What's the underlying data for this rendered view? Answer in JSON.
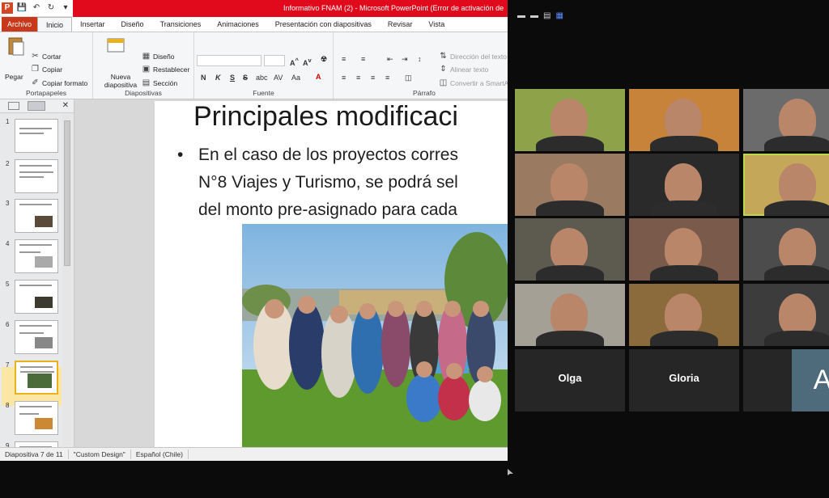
{
  "ppt": {
    "title": "Informativo FNAM (2) - Microsoft PowerPoint (Error de activación de",
    "qat_icon": "P",
    "tabs": [
      "Archivo",
      "Inicio",
      "Insertar",
      "Diseño",
      "Transiciones",
      "Animaciones",
      "Presentación con diapositivas",
      "Revisar",
      "Vista"
    ],
    "ribbon": {
      "portapapeles": {
        "label": "Portapapeles",
        "paste": "Pegar",
        "cut": "Cortar",
        "copy": "Copiar",
        "format": "Copiar formato"
      },
      "diapositivas": {
        "label": "Diapositivas",
        "new": "Nueva diapositiva",
        "layout": "Diseño",
        "reset": "Restablecer",
        "section": "Sección"
      },
      "fuente": {
        "label": "Fuente",
        "bold": "N",
        "italic": "K",
        "underline": "S",
        "strike": "S",
        "aa": "Aa",
        "a": "A"
      },
      "parrafo": {
        "label": "Párrafo",
        "dir": "Dirección del texto",
        "align": "Alinear texto",
        "smart": "Convertir a SmartArt"
      }
    },
    "thumbnails": [
      {
        "num": "1"
      },
      {
        "num": "2"
      },
      {
        "num": "3"
      },
      {
        "num": "4"
      },
      {
        "num": "5"
      },
      {
        "num": "6"
      },
      {
        "num": "7"
      },
      {
        "num": "8"
      },
      {
        "num": "9"
      }
    ],
    "slide": {
      "title": "Principales modificaci",
      "bullet_dot": "•",
      "line1": "En el caso de los proyectos corres",
      "line2": "N°8 Viajes y Turismo, se podrá sel",
      "line3": "del monto pre-asignado  para cada"
    },
    "status": {
      "slide_count": "Diapositiva 7 de 11",
      "theme": "\"Custom Design\"",
      "lang": "Español (Chile)"
    }
  },
  "zoom": {
    "participants": [
      {
        "name": "",
        "bg": "#8ea24a"
      },
      {
        "name": "",
        "bg": "#c8833a"
      },
      {
        "name": "",
        "bg": "#6b6b6b"
      },
      {
        "name": "",
        "bg": "#9b7a62"
      },
      {
        "name": "",
        "bg": "#2a2a2a"
      },
      {
        "name": "",
        "bg": "#c5a75a"
      },
      {
        "name": "",
        "bg": "#5d5a4f"
      },
      {
        "name": "",
        "bg": "#7a5a4a"
      },
      {
        "name": "",
        "bg": "#4c4c4c"
      },
      {
        "name": "",
        "bg": "#a5a096"
      },
      {
        "name": "",
        "bg": "#8b6a3c"
      },
      {
        "name": "",
        "bg": "#3c3c3c"
      },
      {
        "name": "Olga",
        "bg": "#262626"
      },
      {
        "name": "Gloria",
        "bg": "#262626"
      },
      {
        "name": "",
        "bg": "#262626",
        "avatar": "A"
      }
    ]
  }
}
